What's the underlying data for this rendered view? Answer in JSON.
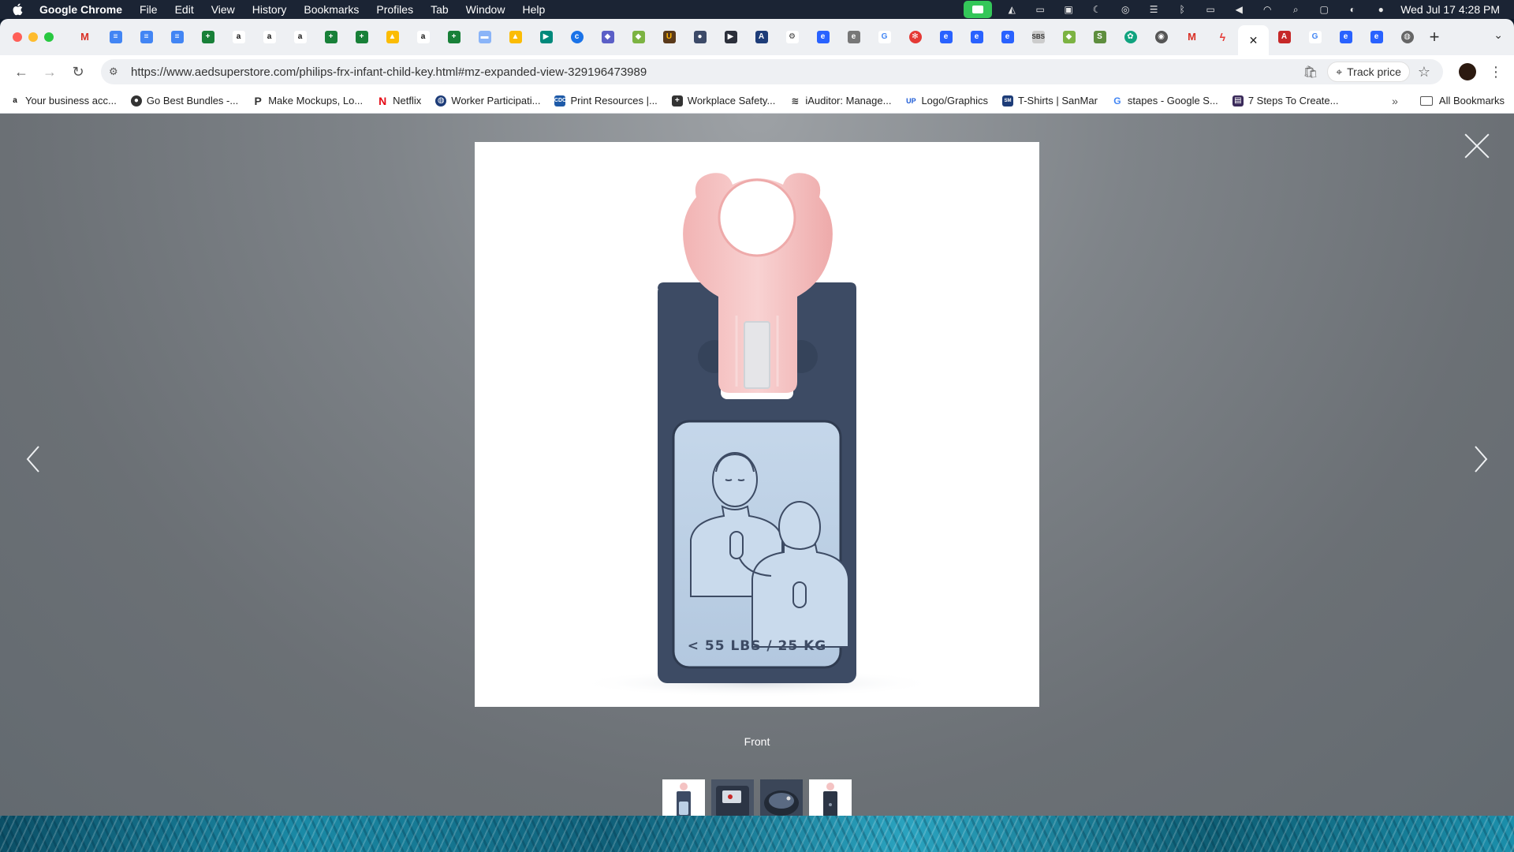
{
  "menubar": {
    "app": "Google Chrome",
    "menus": [
      "File",
      "Edit",
      "View",
      "History",
      "Bookmarks",
      "Profiles",
      "Tab",
      "Window",
      "Help"
    ],
    "clock": "Wed Jul 17  4:28 PM"
  },
  "browser": {
    "url": "https://www.aedsuperstore.com/philips-frx-infant-child-key.html#mz-expanded-view-329196473989",
    "track_price": "Track price",
    "bookmarks": [
      "Your business acc...",
      "Go Best Bundles -...",
      "Make Mockups, Lo...",
      "Netflix",
      "Worker Participati...",
      "Print Resources |...",
      "Workplace Safety...",
      "iAuditor: Manage...",
      "Logo/Graphics",
      "T-Shirts | SanMar",
      "stapes - Google S...",
      "7 Steps To Create..."
    ],
    "all_bookmarks": "All Bookmarks"
  },
  "lightbox": {
    "caption": "Front",
    "product_label": "< 55 LBS / 25 KG",
    "thumbnail_count": 4,
    "active_thumbnail": 1
  },
  "colors": {
    "key_body": "#3d4b64",
    "key_panel": "#bcd0e6",
    "key_tab": "#f4c3c3",
    "overlay": "#7f8489"
  }
}
